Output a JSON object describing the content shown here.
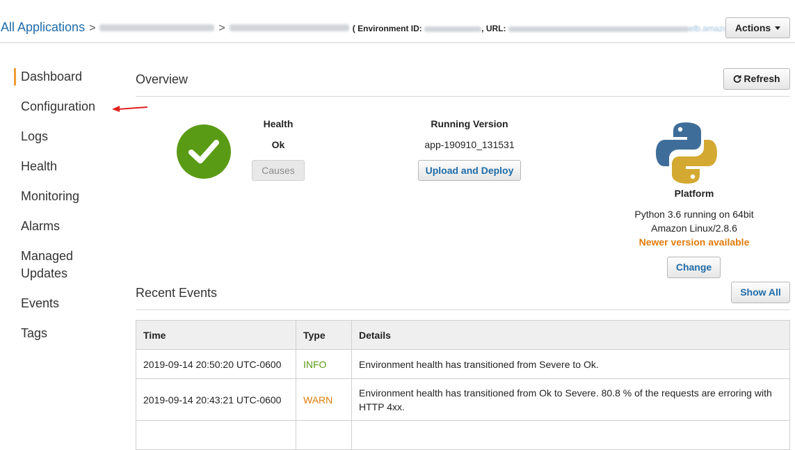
{
  "header": {
    "breadcrumb_root": "All Applications",
    "env_id_label": "Environment ID:",
    "url_label": "URL:",
    "url_suffix": "elb.amazonaws.com",
    "actions_label": "Actions"
  },
  "sidebar": {
    "items": [
      {
        "label": "Dashboard",
        "active": true
      },
      {
        "label": "Configuration"
      },
      {
        "label": "Logs"
      },
      {
        "label": "Health"
      },
      {
        "label": "Monitoring"
      },
      {
        "label": "Alarms"
      },
      {
        "label": "Managed Updates"
      },
      {
        "label": "Events"
      },
      {
        "label": "Tags"
      }
    ]
  },
  "overview": {
    "title": "Overview",
    "refresh_label": "Refresh",
    "health_label": "Health",
    "health_value": "Ok",
    "causes_label": "Causes",
    "running_version_label": "Running Version",
    "running_version_value": "app-190910_131531",
    "upload_deploy_label": "Upload and Deploy",
    "platform_label": "Platform",
    "platform_line1": "Python 3.6 running on 64bit",
    "platform_line2": "Amazon Linux/2.8.6",
    "newer_version": "Newer version available",
    "change_label": "Change"
  },
  "recent_events": {
    "title": "Recent Events",
    "show_all_label": "Show All",
    "columns": [
      "Time",
      "Type",
      "Details"
    ],
    "rows": [
      {
        "time": "2019-09-14 20:50:20 UTC-0600",
        "type": "INFO",
        "details": "Environment health has transitioned from Severe to Ok."
      },
      {
        "time": "2019-09-14 20:43:21 UTC-0600",
        "type": "WARN",
        "details": "Environment health has transitioned from Ok to Severe. 80.8 % of the requests are erroring with HTTP 4xx."
      }
    ]
  },
  "colors": {
    "accent": "#1f6ba8",
    "ok_green": "#5a9b15",
    "warn_orange": "#e07b0c",
    "active_nav": "#f29d38"
  }
}
